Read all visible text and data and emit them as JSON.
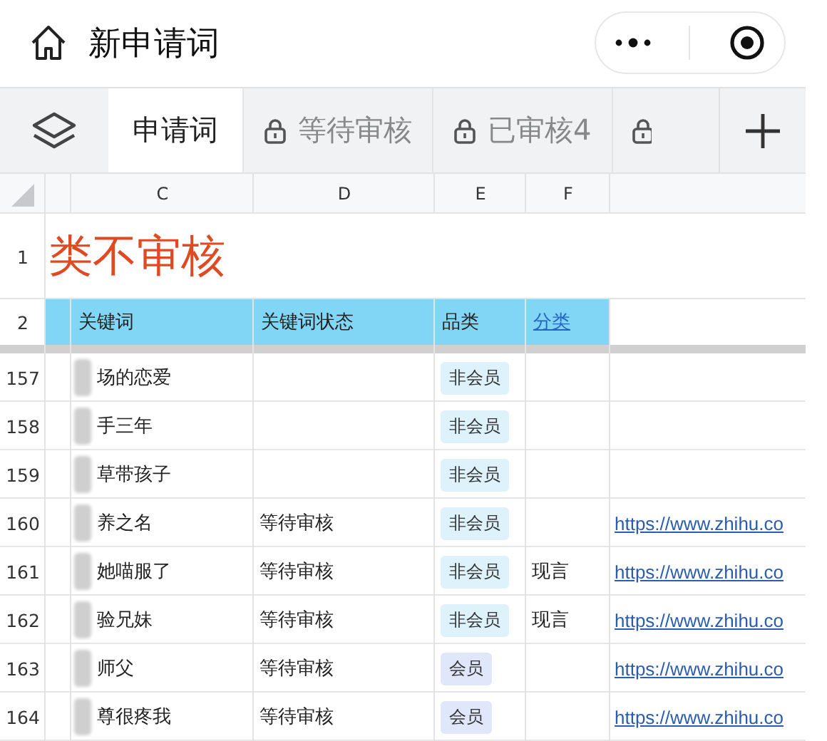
{
  "header": {
    "title": "新申请词"
  },
  "tabs": [
    {
      "label": "申请词",
      "selected": true,
      "locked": false
    },
    {
      "label": "等待审核",
      "selected": false,
      "locked": true
    },
    {
      "label": "已审核4",
      "selected": false,
      "locked": true
    },
    {
      "selected": false,
      "locked": true
    }
  ],
  "sheet": {
    "columns": [
      "C",
      "D",
      "E",
      "F"
    ],
    "title_row": {
      "row_number": "1",
      "text": "类不审核"
    },
    "header_row": {
      "row_number": "2",
      "cells": [
        {
          "text": "关键词",
          "kind": "text"
        },
        {
          "text": "关键词状态",
          "kind": "text"
        },
        {
          "text": "品类",
          "kind": "text"
        },
        {
          "text": "分类",
          "kind": "link"
        }
      ]
    },
    "rows": [
      {
        "row_number": "157",
        "keyword": "场的恋爱",
        "tag": {
          "text": "非会员",
          "color": "#ddf2fb"
        }
      },
      {
        "row_number": "158",
        "keyword": "手三年",
        "tag": {
          "text": "非会员",
          "color": "#ddf2fb"
        }
      },
      {
        "row_number": "159",
        "keyword": "草带孩子",
        "tag": {
          "text": "非会员",
          "color": "#ddf2fb"
        }
      },
      {
        "row_number": "160",
        "keyword": "养之名",
        "status": "等待审核",
        "tag": {
          "text": "非会员",
          "color": "#ddf2fb"
        },
        "link": "https://www.zhihu.co"
      },
      {
        "row_number": "161",
        "keyword": "她喵服了",
        "status": "等待审核",
        "tag": {
          "text": "非会员",
          "color": "#ddf2fb"
        },
        "category": "现言",
        "link": "https://www.zhihu.co"
      },
      {
        "row_number": "162",
        "keyword": "验兄妹",
        "status": "等待审核",
        "tag": {
          "text": "非会员",
          "color": "#ddf2fb"
        },
        "category": "现言",
        "link": "https://www.zhihu.co"
      },
      {
        "row_number": "163",
        "keyword": "师父",
        "status": "等待审核",
        "tag": {
          "text": "会员",
          "color": "#e0e7fb"
        },
        "link": "https://www.zhihu.co"
      },
      {
        "row_number": "164",
        "keyword": "尊很疼我",
        "status": "等待审核",
        "tag": {
          "text": "会员",
          "color": "#e0e7fb"
        },
        "link": "https://www.zhihu.co"
      }
    ]
  }
}
